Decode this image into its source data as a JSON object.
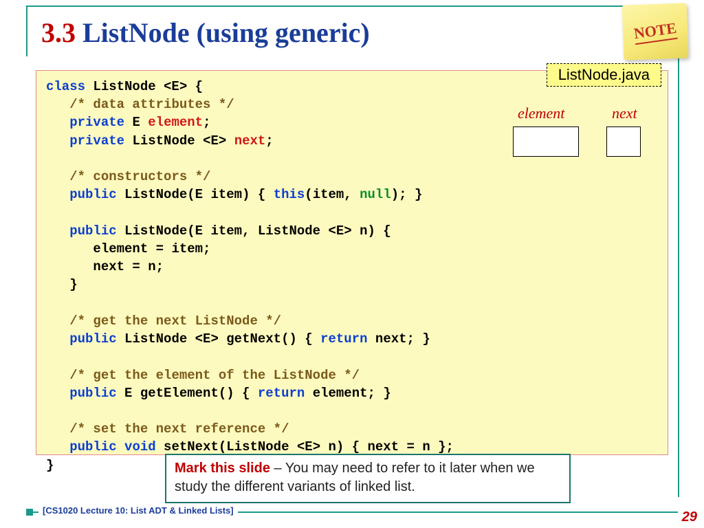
{
  "title": {
    "num": "3.3",
    "text": " ListNode (using generic)"
  },
  "note_sticker": "NOTE",
  "file_tag": "ListNode.java",
  "diagram": {
    "element_label": "element",
    "next_label": "next"
  },
  "code": {
    "l1a": "class",
    "l1b": " ListNode <E> {",
    "l2": "/* data attributes */",
    "l3a": "private",
    "l3b": " E ",
    "l3c": "element",
    "l3d": ";",
    "l4a": "private",
    "l4b": " ListNode <E> ",
    "l4c": "next",
    "l4d": ";",
    "l5": "/* constructors */",
    "l6a": "public",
    "l6b": " ListNode(E item) { ",
    "l6c": "this",
    "l6d": "(item, ",
    "l6e": "null",
    "l6f": "); }",
    "l7a": "public",
    "l7b": " ListNode(E item, ListNode <E> n) {",
    "l8": "element = item;",
    "l9": "next = n;",
    "l10": "}",
    "l11": "/* get the next ListNode */",
    "l12a": "public",
    "l12b": " ListNode <E> getNext() { ",
    "l12c": "return",
    "l12d": " next; }",
    "l13": "/* get the element of the ListNode */",
    "l14a": "public",
    "l14b": " E getElement() { ",
    "l14c": "return",
    "l14d": " element; }",
    "l15": "/* set the next reference */",
    "l16a": "public",
    "l16b": " void",
    "l16c": " setNext(ListNode <E> n) { next = n };",
    "l17": "}"
  },
  "mark": {
    "lead": "Mark this slide",
    "rest": " – You may need to refer to it later when we study the different variants of linked list."
  },
  "footer": "[CS1020 Lecture 10: List ADT & Linked Lists]",
  "page": "29"
}
